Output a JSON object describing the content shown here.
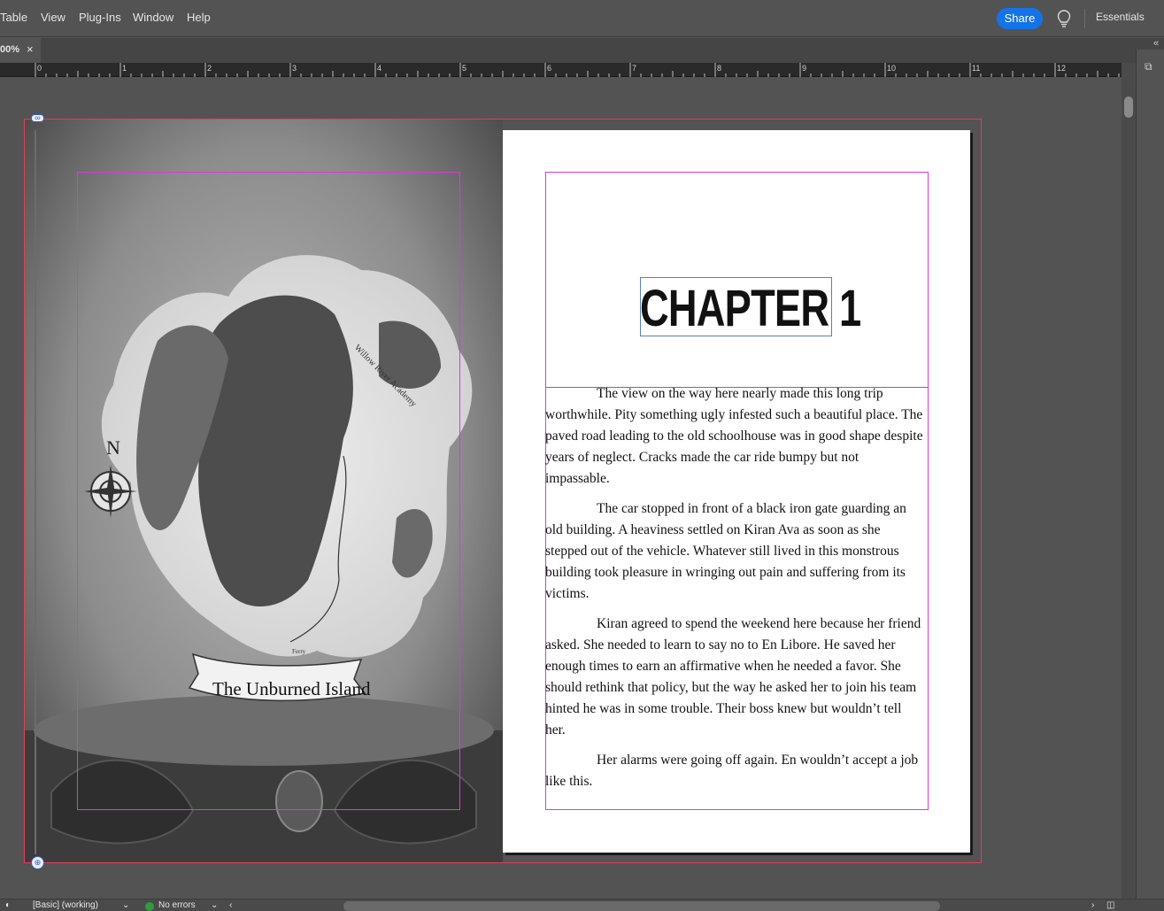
{
  "menu": {
    "items": [
      "Table",
      "View",
      "Plug-Ins",
      "Window",
      "Help"
    ]
  },
  "toolbar": {
    "share_label": "Share",
    "workspace_label": "Essentials",
    "accent": "#1473e6"
  },
  "tab": {
    "zoom_label": "00%",
    "close_label": "×"
  },
  "ruler": {
    "labels": [
      "0",
      "1",
      "2",
      "3",
      "4",
      "5",
      "6",
      "7",
      "8",
      "9",
      "10",
      "11",
      "12"
    ]
  },
  "left_page": {
    "compass_letter": "N",
    "banner_text": "The Unburned Island",
    "map_label": "Willow River Academy",
    "ferry_label": "Ferry"
  },
  "right_page": {
    "chapter_title": "CHAPTER 1",
    "paragraphs": [
      "The view on the way here nearly made this long trip worthwhile. Pity something ugly infested such a beautiful place. The paved road leading to the old schoolhouse was in good shape despite years of neglect. Cracks made the car ride bumpy but not impassable.",
      "The car stopped in front of a black iron gate guarding an old building. A heaviness settled on Kiran Ava as soon as she stepped out of the vehicle. Whatever still lived in this monstrous building took pleasure in wringing out pain and suffering from its victims.",
      "Kiran agreed to spend the weekend here because her friend asked. She needed to learn to say no to En Libore. He saved her enough times to earn an affirmative when he needed a favor. She should rethink that policy, but the way he asked her to join his team hinted he was in some trouble. Their boss knew but wouldn’t tell her.",
      "Her alarms were going off again. En wouldn’t accept a job like this."
    ]
  },
  "status": {
    "style_label": "[Basic] (working)",
    "errors_label": "No errors",
    "ok_color": "#2d9d3e"
  }
}
